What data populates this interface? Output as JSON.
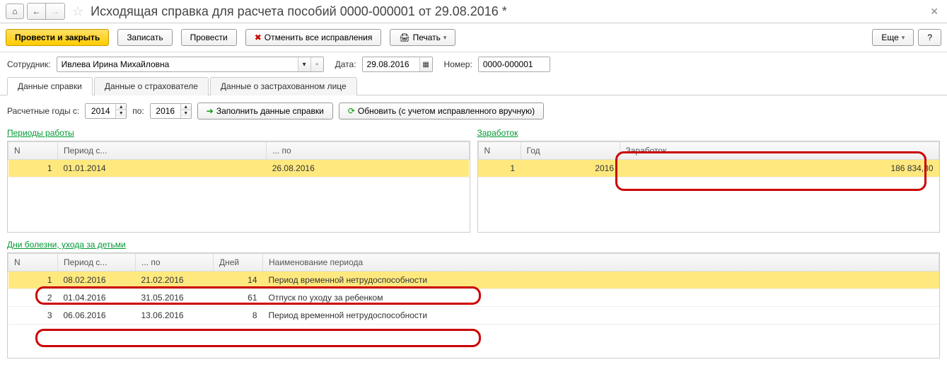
{
  "title": "Исходящая справка для расчета пособий 0000-000001 от 29.08.2016 *",
  "toolbar": {
    "post_close": "Провести и закрыть",
    "save": "Записать",
    "post": "Провести",
    "cancel_fix": "Отменить все исправления",
    "print": "Печать",
    "more": "Еще",
    "help": "?"
  },
  "form": {
    "employee_label": "Сотрудник:",
    "employee_value": "Ивлева Ирина Михайловна",
    "date_label": "Дата:",
    "date_value": "29.08.2016",
    "number_label": "Номер:",
    "number_value": "0000-000001"
  },
  "tabs": {
    "t1": "Данные справки",
    "t2": "Данные о страхователе",
    "t3": "Данные о застрахованном лице"
  },
  "actions": {
    "years_from_label": "Расчетные годы с:",
    "year_from": "2014",
    "years_to_label": "по:",
    "year_to": "2016",
    "fill": "Заполнить данные справки",
    "refresh": "Обновить (с учетом исправленного вручную)"
  },
  "work_periods": {
    "title": "Периоды работы",
    "headers": {
      "n": "N",
      "from": "Период с...",
      "to": "... по"
    },
    "rows": [
      {
        "n": "1",
        "from": "01.01.2014",
        "to": "26.08.2016"
      }
    ]
  },
  "earnings": {
    "title": "Заработок",
    "headers": {
      "n": "N",
      "year": "Год",
      "amount": "Заработок"
    },
    "rows": [
      {
        "n": "1",
        "year": "2016",
        "amount": "186 834,30"
      }
    ]
  },
  "sick": {
    "title": "Дни болезни, ухода за детьми",
    "headers": {
      "n": "N",
      "from": "Период с...",
      "to": "... по",
      "days": "Дней",
      "name": "Наименование периода"
    },
    "rows": [
      {
        "n": "1",
        "from": "08.02.2016",
        "to": "21.02.2016",
        "days": "14",
        "name": "Период временной нетрудоспособности"
      },
      {
        "n": "2",
        "from": "01.04.2016",
        "to": "31.05.2016",
        "days": "61",
        "name": "Отпуск по уходу за ребенком"
      },
      {
        "n": "3",
        "from": "06.06.2016",
        "to": "13.06.2016",
        "days": "8",
        "name": "Период временной нетрудоспособности"
      }
    ]
  }
}
